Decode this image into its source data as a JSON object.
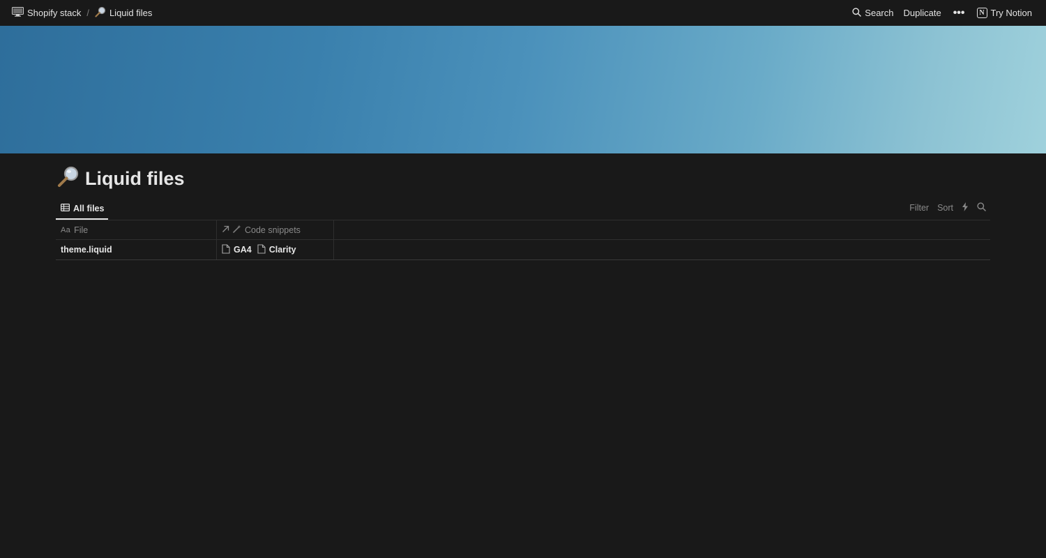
{
  "topbar": {
    "breadcrumbs": [
      {
        "label": "Shopify stack",
        "icon": "desktop-computer-icon"
      },
      {
        "label": "Liquid files",
        "icon": "magnifier-emoji-icon"
      }
    ],
    "separator": "/",
    "actions": {
      "search": "Search",
      "duplicate": "Duplicate",
      "more": "•••",
      "try_notion": "Try Notion"
    }
  },
  "cover": {
    "colors": [
      "#2e6e9b",
      "#4b91bb",
      "#9fd1dc"
    ]
  },
  "page": {
    "title": "Liquid files",
    "title_icon": "magnifier-emoji-icon"
  },
  "database": {
    "views": [
      {
        "label": "All files",
        "icon": "table-icon",
        "active": true
      }
    ],
    "tools": {
      "filter": "Filter",
      "sort": "Sort"
    },
    "columns": [
      {
        "label": "File",
        "type_glyph": "Aa"
      },
      {
        "label": "Code snippets",
        "type": "relation"
      }
    ],
    "rows": [
      {
        "file": "theme.liquid",
        "snippets": [
          "GA4",
          "Clarity"
        ]
      }
    ]
  }
}
